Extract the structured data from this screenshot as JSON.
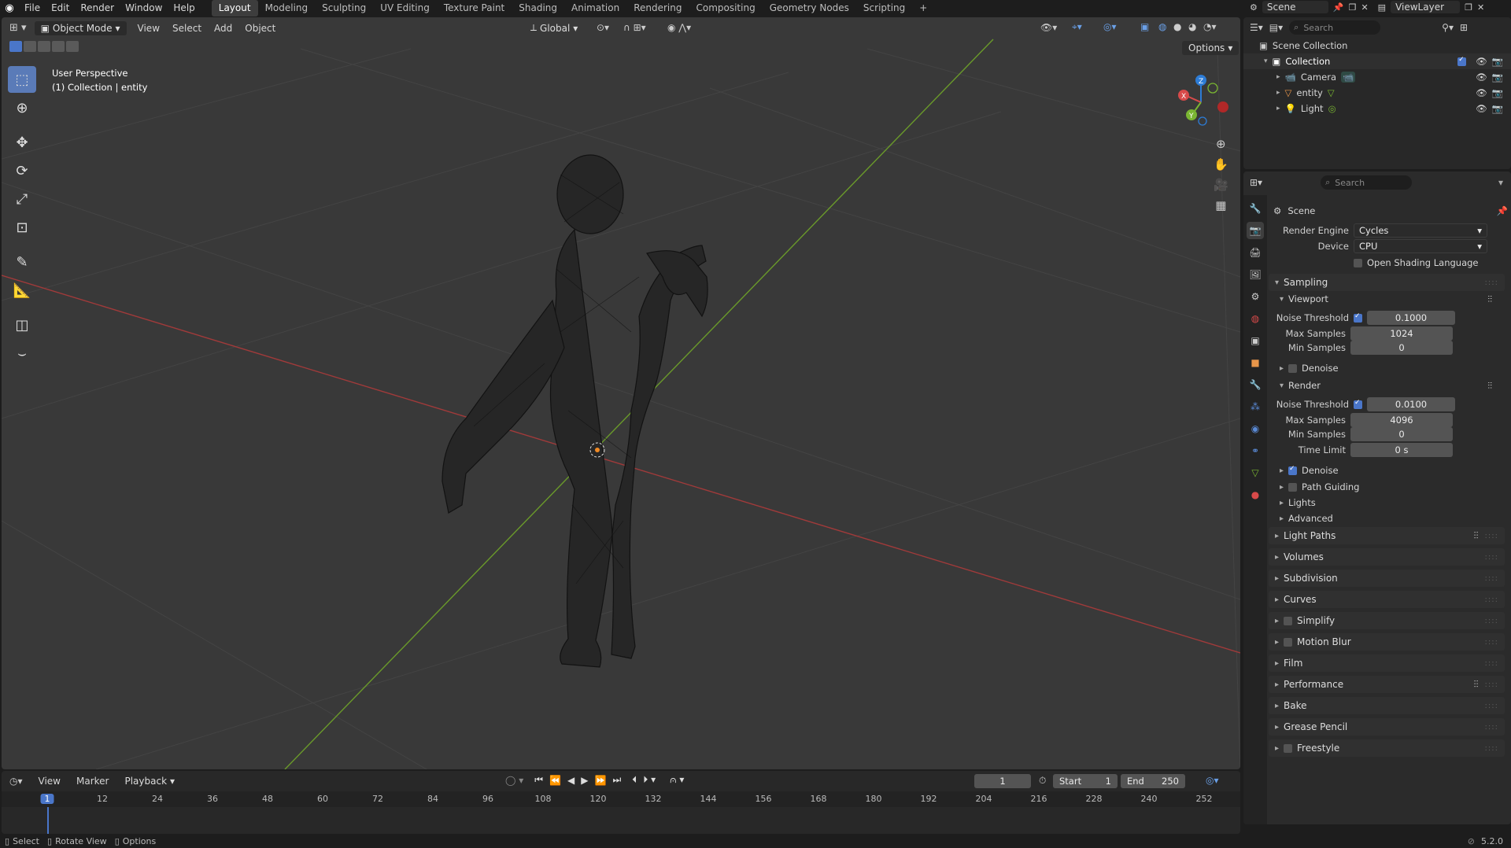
{
  "topbar": {
    "menus": [
      "File",
      "Edit",
      "Render",
      "Window",
      "Help"
    ],
    "workspaces": [
      "Layout",
      "Modeling",
      "Sculpting",
      "UV Editing",
      "Texture Paint",
      "Shading",
      "Animation",
      "Rendering",
      "Compositing",
      "Geometry Nodes",
      "Scripting"
    ],
    "active_workspace": "Layout",
    "add_tab": "+",
    "scene": "Scene",
    "view_layer": "ViewLayer"
  },
  "viewport": {
    "mode": "Object Mode",
    "menus": [
      "View",
      "Select",
      "Add",
      "Object"
    ],
    "transform_orientation": "Global",
    "options": "Options",
    "overlay_title": "User Perspective",
    "overlay_sub": "(1) Collection | entity",
    "gizmo": {
      "x": "X",
      "y": "Y",
      "z": "Z"
    }
  },
  "outliner": {
    "search_placeholder": "Search",
    "root": "Scene Collection",
    "collection": "Collection",
    "items": [
      "Camera",
      "entity",
      "Light"
    ]
  },
  "properties": {
    "search_placeholder": "Search",
    "context": "Scene",
    "render_engine_label": "Render Engine",
    "render_engine": "Cycles",
    "device_label": "Device",
    "device": "CPU",
    "osl": "Open Shading Language",
    "sampling": "Sampling",
    "viewport": {
      "title": "Viewport",
      "noise_threshold_label": "Noise Threshold",
      "noise_threshold": "0.1000",
      "max_samples_label": "Max Samples",
      "max_samples": "1024",
      "min_samples_label": "Min Samples",
      "min_samples": "0",
      "denoise": "Denoise"
    },
    "render": {
      "title": "Render",
      "noise_threshold_label": "Noise Threshold",
      "noise_threshold": "0.0100",
      "max_samples_label": "Max Samples",
      "max_samples": "4096",
      "min_samples_label": "Min Samples",
      "min_samples": "0",
      "time_limit_label": "Time Limit",
      "time_limit": "0 s",
      "denoise": "Denoise"
    },
    "subpanels": [
      "Path Guiding",
      "Lights",
      "Advanced"
    ],
    "panels": [
      "Light Paths",
      "Volumes",
      "Subdivision",
      "Curves",
      "Simplify",
      "Motion Blur",
      "Film",
      "Performance",
      "Bake",
      "Grease Pencil",
      "Freestyle"
    ]
  },
  "timeline": {
    "menus": [
      "View",
      "Marker",
      "Playback"
    ],
    "current_frame": "1",
    "start_label": "Start",
    "start": "1",
    "end_label": "End",
    "end": "250",
    "ticks": [
      "1",
      "12",
      "24",
      "36",
      "48",
      "60",
      "72",
      "84",
      "96",
      "108",
      "120",
      "132",
      "144",
      "156",
      "168",
      "180",
      "192",
      "204",
      "216",
      "228",
      "240",
      "252"
    ]
  },
  "statusbar": {
    "select": "Select",
    "rotate": "Rotate View",
    "options": "Options",
    "version": "5.2.0"
  },
  "colors": {
    "accent": "#4a76c9",
    "x_axis": "#d84a4a",
    "y_axis": "#7ab632",
    "z_axis": "#2d7cd6"
  }
}
